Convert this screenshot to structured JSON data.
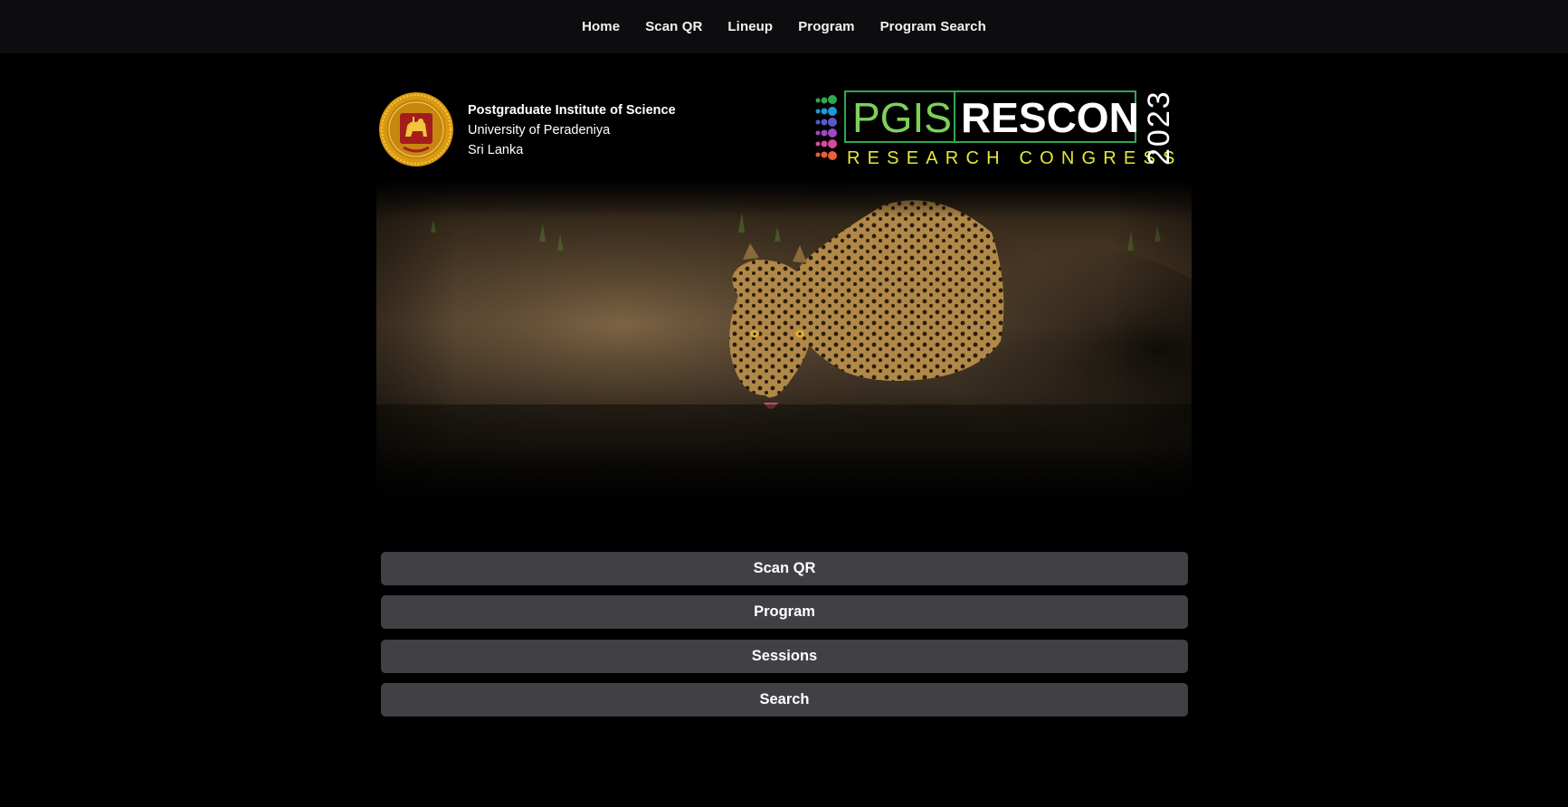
{
  "nav": {
    "items": [
      {
        "label": "Home"
      },
      {
        "label": "Scan QR"
      },
      {
        "label": "Lineup"
      },
      {
        "label": "Program"
      },
      {
        "label": "Program Search"
      }
    ]
  },
  "header": {
    "institute_name": "Postgraduate Institute of Science",
    "university": "University of Peradeniya",
    "country": "Sri Lanka",
    "logo": {
      "word1": "PGIS",
      "word2": "RESCON",
      "tagline": "RESEARCH CONGRESS",
      "year": "2023"
    }
  },
  "actions": [
    {
      "label": "Scan QR"
    },
    {
      "label": "Program"
    },
    {
      "label": "Sessions"
    },
    {
      "label": "Search"
    }
  ],
  "colors": {
    "nav_bg": "#0d0d0f",
    "button_bg": "#404045",
    "logo_green": "#7dd05a",
    "logo_yellow": "#e6e832",
    "seal_gold": "#e0a91c"
  }
}
